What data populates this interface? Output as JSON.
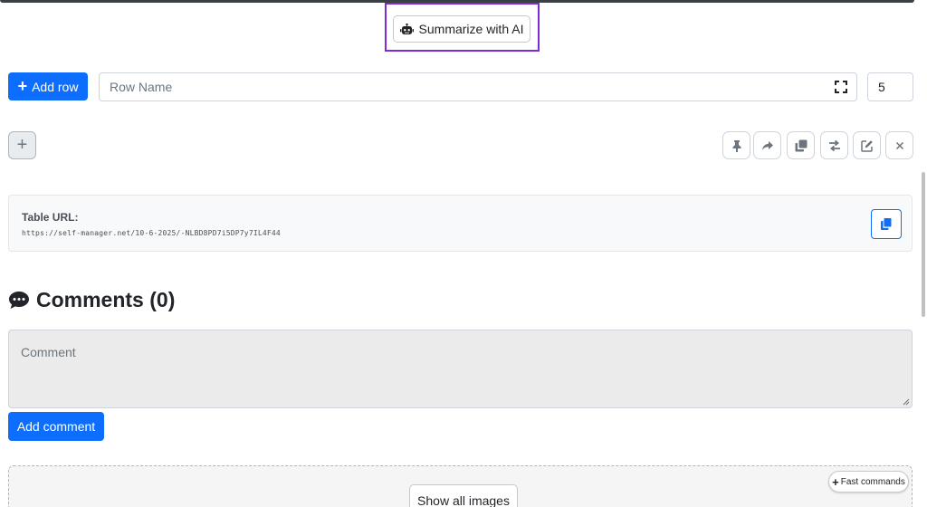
{
  "summarize": {
    "label": "Summarize with AI",
    "icon": "robot-icon"
  },
  "toolbar": {
    "add_row_label": "Add row",
    "row_name_placeholder": "Row Name",
    "row_count": "5"
  },
  "actions": {
    "icons": [
      "thumbtack-icon",
      "share-icon",
      "clone-icon",
      "swap-icon",
      "edit-icon",
      "close-icon"
    ]
  },
  "table_url": {
    "label": "Table URL:",
    "value": "https://self-manager.net/10-6-2025/-NLBD8PD7i5DP7y7IL4F44"
  },
  "comments": {
    "title": "Comments (0)",
    "placeholder": "Comment",
    "add_label": "Add comment"
  },
  "images": {
    "show_all_label": "Show all images",
    "fast_commands_label": "Fast commands"
  },
  "colors": {
    "primary": "#0d6efd",
    "highlight": "#7d2bd8"
  }
}
